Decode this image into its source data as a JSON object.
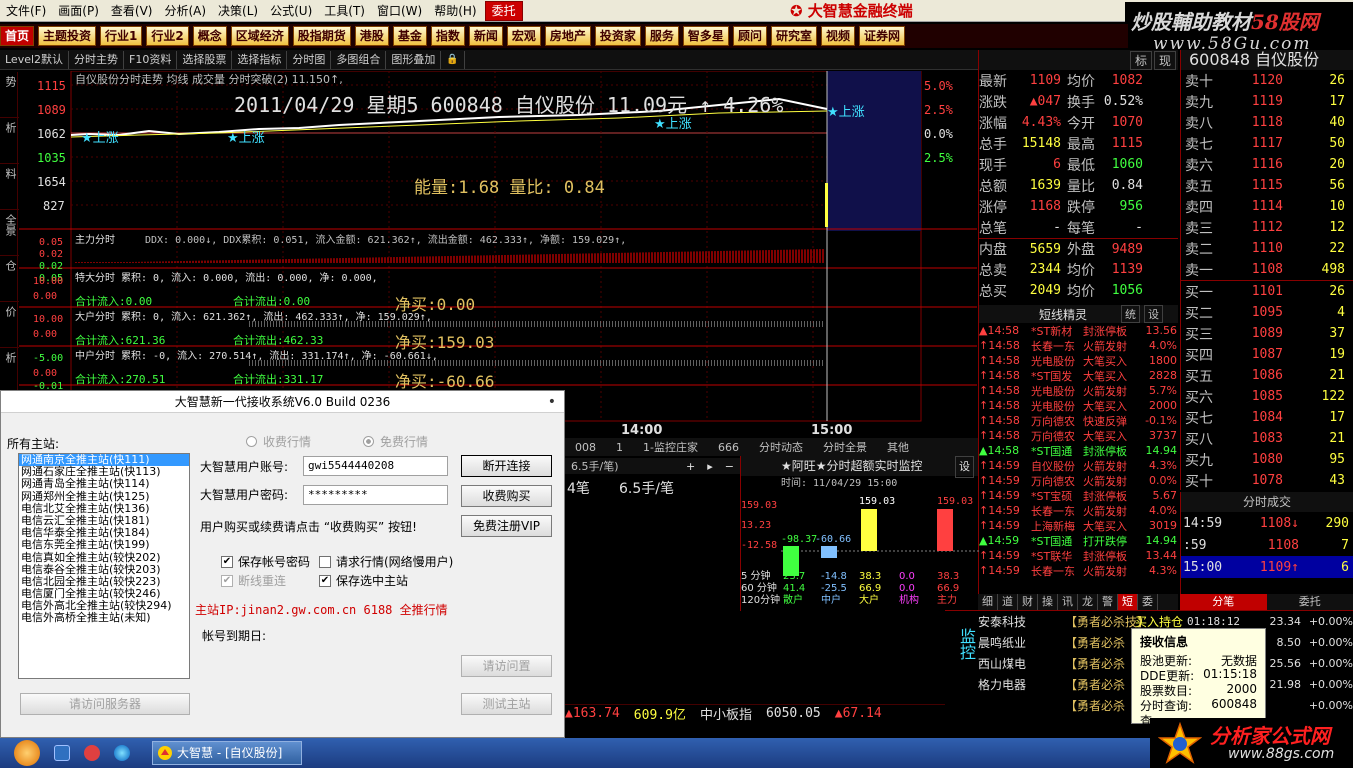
{
  "menu": {
    "items": [
      "文件(F)",
      "画面(P)",
      "查看(V)",
      "分析(A)",
      "决策(L)",
      "公式(U)",
      "工具(T)",
      "窗口(W)",
      "帮助(H)"
    ],
    "entrust": "委托",
    "app_title": "大智慧金融终端"
  },
  "brand": {
    "line1a": "炒股輔助教材",
    "line1b": "58股网",
    "line2": "www.58Gu.com"
  },
  "tabs": [
    "首页",
    "主题投资",
    "行业1",
    "行业2",
    "概念",
    "区域经济",
    "股指期货",
    "港股",
    "基金",
    "指数",
    "新闻",
    "宏观",
    "房地产",
    "投资家",
    "服务",
    "智多星",
    "顾问",
    "研究室",
    "视频",
    "证券网"
  ],
  "toolbar": [
    "Level2默认",
    "分时主势",
    "F10资料",
    "选择股票",
    "选择指标",
    "分时图",
    "多图组合",
    "图形叠加"
  ],
  "vtabs": [
    "分时走势",
    "技术分析",
    "基本资料",
    "全景",
    "基金持仓",
    "相关报价",
    "财务分析"
  ],
  "chart": {
    "title": "自仪股份分时走势 均线 成交量 分时突破(2) 11.150↑,",
    "big_date": "2011/04/29 星期5  600848 自仪股份 11.09元 ↑ 4.26%",
    "energy": "能量:1.68  量比: 0.84",
    "left_axis": [
      "1115",
      "1089",
      "1062",
      "1035",
      "1654",
      "827"
    ],
    "right_axis": [
      "5.0%",
      "2.5%",
      "0.0%",
      "2.5%"
    ],
    "up_label": "★上涨",
    "main_line": "主力分时",
    "main_stats": "DDX: 0.000↓, DDX累积: 0.051, 流入金额: 621.362↑, 流出金额: 462.333↑, 净额: 159.029↑,",
    "main_axis": [
      "0.05",
      "0.02",
      "0.02",
      "0.05"
    ],
    "super_line": "特大分时 累积: 0, 流入: 0.000, 流出: 0.000, 净: 0.000,",
    "super_in": "合计流入:0.00",
    "super_out": "合计流出:0.00",
    "super_net": "净买:0.00",
    "big_line": "大户分时 累积: 0, 流入: 621.362↑, 流出: 462.333↑, 净: 159.029↑,",
    "big_in": "合计流入:621.36",
    "big_out": "合计流出:462.33",
    "big_net": "净买:159.03",
    "mid_line": "中户分时 累积: -0, 流入: 270.514↑, 流出: 331.174↑, 净: -60.661↓,",
    "mid_in": "合计流入:270.51",
    "mid_out": "合计流出:331.17",
    "mid_net": "净买:-60.66",
    "axis_other": [
      "10.00",
      "0.00",
      "10.00",
      "0.00",
      "-5.00",
      "0.00",
      "-0.01"
    ],
    "time_labels": [
      "14:00",
      "15:00"
    ]
  },
  "quote": {
    "header": [
      "标",
      "现"
    ],
    "rows": [
      {
        "l1": "最新",
        "v1": "1109",
        "c1": "red",
        "l2": "均价",
        "v2": "1082",
        "c2": "red"
      },
      {
        "l1": "涨跌",
        "v1": "▲047",
        "c1": "red",
        "l2": "换手",
        "v2": "0.52%",
        "c2": "white"
      },
      {
        "l1": "涨幅",
        "v1": "4.43%",
        "c1": "red",
        "l2": "今开",
        "v2": "1070",
        "c2": "red"
      },
      {
        "l1": "总手",
        "v1": "15148",
        "c1": "yellow",
        "l2": "最高",
        "v2": "1115",
        "c2": "red"
      },
      {
        "l1": "现手",
        "v1": "6",
        "c1": "red",
        "l2": "最低",
        "v2": "1060",
        "c2": "green"
      },
      {
        "l1": "总额",
        "v1": "1639",
        "c1": "yellow",
        "l2": "量比",
        "v2": "0.84",
        "c2": "white"
      },
      {
        "l1": "涨停",
        "v1": "1168",
        "c1": "red",
        "l2": "跌停",
        "v2": "956",
        "c2": "green"
      },
      {
        "l1": "总笔",
        "v1": "-",
        "c1": "white",
        "l2": "每笔",
        "v2": "-",
        "c2": "white"
      },
      {
        "l1": "内盘",
        "v1": "5659",
        "c1": "yellow",
        "l2": "外盘",
        "v2": "9489",
        "c2": "red"
      },
      {
        "l1": "总卖",
        "v1": "2344",
        "c1": "yellow",
        "l2": "均价",
        "v2": "1139",
        "c2": "red"
      },
      {
        "l1": "总买",
        "v1": "2049",
        "c1": "yellow",
        "l2": "均价",
        "v2": "1056",
        "c2": "green"
      }
    ]
  },
  "book": {
    "code": "600848 自仪股份",
    "sells": [
      {
        "l": "卖十",
        "p": "1120",
        "v": "26",
        "a": "↑"
      },
      {
        "l": "卖九",
        "p": "1119",
        "v": "17",
        "a": ""
      },
      {
        "l": "卖八",
        "p": "1118",
        "v": "40",
        "a": ""
      },
      {
        "l": "卖七",
        "p": "1117",
        "v": "50",
        "a": ""
      },
      {
        "l": "卖六",
        "p": "1116",
        "v": "20",
        "a": ""
      },
      {
        "l": "卖五",
        "p": "1115",
        "v": "56",
        "a": ""
      },
      {
        "l": "卖四",
        "p": "1114",
        "v": "10",
        "a": ""
      },
      {
        "l": "卖三",
        "p": "1112",
        "v": "12",
        "a": ""
      },
      {
        "l": "卖二",
        "p": "1110",
        "v": "22",
        "a": ""
      },
      {
        "l": "卖一",
        "p": "1108",
        "v": "498",
        "a": ""
      }
    ],
    "buys": [
      {
        "l": "买一",
        "p": "1101",
        "v": "26"
      },
      {
        "l": "买二",
        "p": "1095",
        "v": "4"
      },
      {
        "l": "买三",
        "p": "1089",
        "v": "37"
      },
      {
        "l": "买四",
        "p": "1087",
        "v": "19"
      },
      {
        "l": "买五",
        "p": "1086",
        "v": "21"
      },
      {
        "l": "买六",
        "p": "1085",
        "v": "122"
      },
      {
        "l": "买七",
        "p": "1084",
        "v": "17"
      },
      {
        "l": "买八",
        "p": "1083",
        "v": "21"
      },
      {
        "l": "买九",
        "p": "1080",
        "v": "95"
      },
      {
        "l": "买十",
        "p": "1078",
        "v": "43"
      }
    ]
  },
  "sprite": {
    "title": "短线精灵",
    "tabs": [
      "统",
      "设"
    ],
    "rows": [
      {
        "t": "▲14:58",
        "n": "*ST新材",
        "a": "封涨停板",
        "v": "13.56",
        "g": false
      },
      {
        "t": "↑14:58",
        "n": "长春一东",
        "a": "火箭发射",
        "v": "4.0%",
        "g": false
      },
      {
        "t": "↑14:58",
        "n": "光电股份",
        "a": "大笔买入",
        "v": "1800",
        "g": false
      },
      {
        "t": "↑14:58",
        "n": "*ST国发",
        "a": "大笔买入",
        "v": "2828",
        "g": false
      },
      {
        "t": "↑14:58",
        "n": "光电股份",
        "a": "火箭发射",
        "v": "5.7%",
        "g": false
      },
      {
        "t": "↑14:58",
        "n": "光电股份",
        "a": "大笔买入",
        "v": "2000",
        "g": false
      },
      {
        "t": "↑14:58",
        "n": "万向德农",
        "a": "快速反弹",
        "v": "-0.1%",
        "g": false
      },
      {
        "t": "↑14:58",
        "n": "万向德农",
        "a": "大笔买入",
        "v": "3737",
        "g": false
      },
      {
        "t": "▲14:58",
        "n": "*ST国通",
        "a": "封涨停板",
        "v": "14.94",
        "g": true
      },
      {
        "t": "↑14:59",
        "n": "自仪股份",
        "a": "火箭发射",
        "v": "4.3%",
        "g": false
      },
      {
        "t": "↑14:59",
        "n": "万向德农",
        "a": "火箭发射",
        "v": "0.0%",
        "g": false
      },
      {
        "t": "↑14:59",
        "n": "*ST宝硕",
        "a": "封涨停板",
        "v": "5.67",
        "g": false
      },
      {
        "t": "↑14:59",
        "n": "长春一东",
        "a": "火箭发射",
        "v": "4.0%",
        "g": false
      },
      {
        "t": "↑14:59",
        "n": "上海新梅",
        "a": "大笔买入",
        "v": "3019",
        "g": false
      },
      {
        "t": "▲14:59",
        "n": "*ST国通",
        "a": "打开跌停",
        "v": "14.94",
        "g": true
      },
      {
        "t": "↑14:59",
        "n": "*ST联华",
        "a": "封涨停板",
        "v": "13.44",
        "g": false
      },
      {
        "t": "↑14:59",
        "n": "长春一东",
        "a": "火箭发射",
        "v": "4.3%",
        "g": false
      }
    ],
    "bottom_tabs": [
      "细",
      "道",
      "财",
      "操",
      "讯",
      "龙",
      "警",
      "短",
      "委"
    ],
    "bottom_active": "短"
  },
  "ticks": {
    "title": "分时成交",
    "rows": [
      {
        "t": "14:59",
        "p": "1108↓",
        "v": "290"
      },
      {
        "t": "  :59",
        "p": "1108",
        "v": "7"
      },
      {
        "t": "15:00",
        "p": "1109↑",
        "v": "6"
      }
    ],
    "tabs": [
      "分笔",
      "委托"
    ],
    "active": "分笔"
  },
  "midbar": [
    "008",
    "1",
    "1-监控庄家",
    "666",
    "分时动态",
    "分时全景",
    "其他"
  ],
  "leftmid": {
    "line": "6.5手/笔)",
    "val1": "4笔",
    "val2": "6.5手/笔"
  },
  "monitor": {
    "title": "★阿旺★分时超额实时监控",
    "tab": "设",
    "subtitle": "时间: 11/04/29 15:00",
    "top_labels": [
      "159.03",
      "159.03"
    ],
    "axis": [
      "159.03",
      "13.23",
      "-12.58",
      "-98.37"
    ],
    "bar_labels": [
      "-98.37",
      "-60.66"
    ],
    "table": [
      {
        "k": "5 分钟",
        "a": "23.7",
        "b": "-14.8",
        "c": "38.3",
        "d": "0.0",
        "e": "38.3"
      },
      {
        "k": "60 分钟",
        "a": "41.4",
        "b": "-25.5",
        "c": "66.9",
        "d": "0.0",
        "e": "66.9"
      },
      {
        "k": "120分钟",
        "a": "散户",
        "b": "中户",
        "c": "大户",
        "d": "机构",
        "e": "主力"
      }
    ]
  },
  "ticker": [
    {
      "t": "▲163.74",
      "c": "red"
    },
    {
      "t": "609.9亿",
      "c": "yellow"
    },
    {
      "t": "中小板指",
      "c": "white"
    },
    {
      "t": "6050.05",
      "c": "white"
    },
    {
      "t": "▲67.14",
      "c": "red"
    }
  ],
  "stocklist": {
    "label": "监控",
    "rows": [
      {
        "n": "安泰科技",
        "t": "【勇者必杀技】",
        "x": "买入持仓",
        "y": "01:18:12",
        "z": "23.34",
        "w": "+0.00%"
      },
      {
        "n": "晨鸣纸业",
        "t": "【勇者必杀",
        "x": "",
        "y": "",
        "z": "8.50",
        "w": "+0.00%"
      },
      {
        "n": "西山煤电",
        "t": "【勇者必杀",
        "x": "",
        "y": "",
        "z": "25.56",
        "w": "+0.00%"
      },
      {
        "n": "格力电器",
        "t": "【勇者必杀",
        "x": "",
        "y": "",
        "z": "21.98",
        "w": "+0.00%"
      },
      {
        "n": "",
        "t": "【勇者必杀",
        "x": "",
        "y": "",
        "z": "",
        "w": "+0.00%"
      }
    ]
  },
  "infobox": {
    "title": "接收信息",
    "rows": [
      {
        "k": "股池更新:",
        "v": "无数据"
      },
      {
        "k": "DDE更新:",
        "v": "01:15:18"
      },
      {
        "k": "股票数目:",
        "v": "2000"
      },
      {
        "k": "分时查询:",
        "v": "600848"
      },
      {
        "k": "查",
        "v": ""
      }
    ]
  },
  "corner": {
    "c1": "分析家公式网",
    "c2": "www.88gs.com"
  },
  "dialog": {
    "title": "大智慧新一代接收系统V6.0 Build 0236",
    "close": "•",
    "servers_label": "所有主站:",
    "servers": [
      "网通南京全推主站(快111)",
      "网通石家庄全推主站(快113)",
      "网通青岛全推主站(快114)",
      "网通郑州全推主站(快125)",
      "电信北艾全推主站(快136)",
      "电信云汇全推主站(快181)",
      "电信华泰全推主站(快184)",
      "电信东莞全推主站(快199)",
      "电信真如全推主站(较快202)",
      "电信泰谷全推主站(较快203)",
      "电信北园全推主站(较快223)",
      "电信厦门全推主站(较快246)",
      "电信外高北全推主站(较快294)",
      "电信外高桥全推主站(未知)"
    ],
    "selected": 0,
    "radio_paid": "收费行情",
    "radio_free": "免费行情",
    "account_label": "大智慧用户账号:",
    "account_value": "gwi5544440208",
    "password_label": "大智慧用户密码:",
    "password_value": "*********",
    "btn_disconnect": "断开连接",
    "btn_buy": "收费购买",
    "btn_register": "免费注册VIP",
    "note": "用户购买或续费请点击 “收费购买” 按钮!",
    "chk_save_pwd": "保存帐号密码",
    "chk_request": "请求行情(网络慢用户)",
    "chk_reconnect": "断线重连",
    "chk_save_site": "保存选中主站",
    "server_ip": "主站IP:jinan2.gw.com.cn 6188 全推行情",
    "expire_label": "帐号到期日:",
    "btn_refresh": "请访问服务器",
    "btn_request": "请访问置",
    "btn_test": "测试主站"
  },
  "taskbar": {
    "task": "大智慧 - [自仪股份]"
  }
}
